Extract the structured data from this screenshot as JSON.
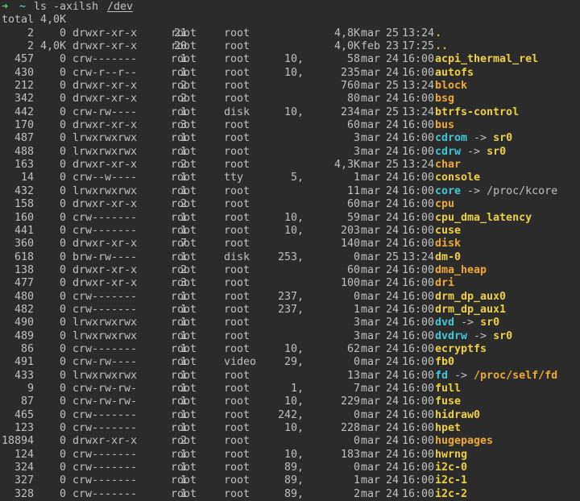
{
  "prompt": {
    "arrow": "➜",
    "cwd": "~",
    "command": "ls -axilsh",
    "argument": "/dev"
  },
  "total_line": "total 4,0K",
  "entries": [
    {
      "inode": "2",
      "blocks": "0",
      "perm": "drwxr-xr-x",
      "links": "21",
      "owner": "root",
      "group": "root",
      "major": "",
      "size": "4,8K",
      "month": "mar",
      "day": "25",
      "time": "13:24",
      "name": ".",
      "kind": "dot",
      "target": "",
      "target_kind": ""
    },
    {
      "inode": "2",
      "blocks": "4,0K",
      "perm": "drwxr-xr-x",
      "links": "20",
      "owner": "root",
      "group": "root",
      "major": "",
      "size": "4,0K",
      "month": "feb",
      "day": "23",
      "time": "17:25",
      "name": "..",
      "kind": "dot",
      "target": "",
      "target_kind": ""
    },
    {
      "inode": "457",
      "blocks": "0",
      "perm": "crw-------",
      "links": "1",
      "owner": "root",
      "group": "root",
      "major": "10,",
      "size": "58",
      "month": "mar",
      "day": "24",
      "time": "16:00",
      "name": "acpi_thermal_rel",
      "kind": "char",
      "target": "",
      "target_kind": ""
    },
    {
      "inode": "430",
      "blocks": "0",
      "perm": "crw-r--r--",
      "links": "1",
      "owner": "root",
      "group": "root",
      "major": "10,",
      "size": "235",
      "month": "mar",
      "day": "24",
      "time": "16:00",
      "name": "autofs",
      "kind": "char",
      "target": "",
      "target_kind": ""
    },
    {
      "inode": "212",
      "blocks": "0",
      "perm": "drwxr-xr-x",
      "links": "2",
      "owner": "root",
      "group": "root",
      "major": "",
      "size": "760",
      "month": "mar",
      "day": "25",
      "time": "13:24",
      "name": "block",
      "kind": "dir",
      "target": "",
      "target_kind": ""
    },
    {
      "inode": "342",
      "blocks": "0",
      "perm": "drwxr-xr-x",
      "links": "2",
      "owner": "root",
      "group": "root",
      "major": "",
      "size": "80",
      "month": "mar",
      "day": "24",
      "time": "16:00",
      "name": "bsg",
      "kind": "dir",
      "target": "",
      "target_kind": ""
    },
    {
      "inode": "442",
      "blocks": "0",
      "perm": "crw-rw----",
      "links": "1",
      "owner": "root",
      "group": "disk",
      "major": "10,",
      "size": "234",
      "month": "mar",
      "day": "25",
      "time": "13:24",
      "name": "btrfs-control",
      "kind": "char",
      "target": "",
      "target_kind": ""
    },
    {
      "inode": "170",
      "blocks": "0",
      "perm": "drwxr-xr-x",
      "links": "3",
      "owner": "root",
      "group": "root",
      "major": "",
      "size": "60",
      "month": "mar",
      "day": "24",
      "time": "16:00",
      "name": "bus",
      "kind": "dir",
      "target": "",
      "target_kind": ""
    },
    {
      "inode": "487",
      "blocks": "0",
      "perm": "lrwxrwxrwx",
      "links": "1",
      "owner": "root",
      "group": "root",
      "major": "",
      "size": "3",
      "month": "mar",
      "day": "24",
      "time": "16:00",
      "name": "cdrom",
      "kind": "link",
      "target": "sr0",
      "target_kind": "char"
    },
    {
      "inode": "488",
      "blocks": "0",
      "perm": "lrwxrwxrwx",
      "links": "1",
      "owner": "root",
      "group": "root",
      "major": "",
      "size": "3",
      "month": "mar",
      "day": "24",
      "time": "16:00",
      "name": "cdrw",
      "kind": "link",
      "target": "sr0",
      "target_kind": "char"
    },
    {
      "inode": "163",
      "blocks": "0",
      "perm": "drwxr-xr-x",
      "links": "2",
      "owner": "root",
      "group": "root",
      "major": "",
      "size": "4,3K",
      "month": "mar",
      "day": "25",
      "time": "13:24",
      "name": "char",
      "kind": "dir",
      "target": "",
      "target_kind": ""
    },
    {
      "inode": "14",
      "blocks": "0",
      "perm": "crw--w----",
      "links": "1",
      "owner": "root",
      "group": "tty",
      "major": "5,",
      "size": "1",
      "month": "mar",
      "day": "24",
      "time": "16:00",
      "name": "console",
      "kind": "char",
      "target": "",
      "target_kind": ""
    },
    {
      "inode": "432",
      "blocks": "0",
      "perm": "lrwxrwxrwx",
      "links": "1",
      "owner": "root",
      "group": "root",
      "major": "",
      "size": "11",
      "month": "mar",
      "day": "24",
      "time": "16:00",
      "name": "core",
      "kind": "link",
      "target": "/proc/kcore",
      "target_kind": "plain"
    },
    {
      "inode": "158",
      "blocks": "0",
      "perm": "drwxr-xr-x",
      "links": "2",
      "owner": "root",
      "group": "root",
      "major": "",
      "size": "60",
      "month": "mar",
      "day": "24",
      "time": "16:00",
      "name": "cpu",
      "kind": "dir",
      "target": "",
      "target_kind": ""
    },
    {
      "inode": "160",
      "blocks": "0",
      "perm": "crw-------",
      "links": "1",
      "owner": "root",
      "group": "root",
      "major": "10,",
      "size": "59",
      "month": "mar",
      "day": "24",
      "time": "16:00",
      "name": "cpu_dma_latency",
      "kind": "char",
      "target": "",
      "target_kind": ""
    },
    {
      "inode": "441",
      "blocks": "0",
      "perm": "crw-------",
      "links": "1",
      "owner": "root",
      "group": "root",
      "major": "10,",
      "size": "203",
      "month": "mar",
      "day": "24",
      "time": "16:00",
      "name": "cuse",
      "kind": "char",
      "target": "",
      "target_kind": ""
    },
    {
      "inode": "360",
      "blocks": "0",
      "perm": "drwxr-xr-x",
      "links": "7",
      "owner": "root",
      "group": "root",
      "major": "",
      "size": "140",
      "month": "mar",
      "day": "24",
      "time": "16:00",
      "name": "disk",
      "kind": "dir",
      "target": "",
      "target_kind": ""
    },
    {
      "inode": "618",
      "blocks": "0",
      "perm": "brw-rw----",
      "links": "1",
      "owner": "root",
      "group": "disk",
      "major": "253,",
      "size": "0",
      "month": "mar",
      "day": "25",
      "time": "13:24",
      "name": "dm-0",
      "kind": "block",
      "target": "",
      "target_kind": ""
    },
    {
      "inode": "138",
      "blocks": "0",
      "perm": "drwxr-xr-x",
      "links": "2",
      "owner": "root",
      "group": "root",
      "major": "",
      "size": "60",
      "month": "mar",
      "day": "24",
      "time": "16:00",
      "name": "dma_heap",
      "kind": "dir",
      "target": "",
      "target_kind": ""
    },
    {
      "inode": "477",
      "blocks": "0",
      "perm": "drwxr-xr-x",
      "links": "3",
      "owner": "root",
      "group": "root",
      "major": "",
      "size": "100",
      "month": "mar",
      "day": "24",
      "time": "16:00",
      "name": "dri",
      "kind": "dir",
      "target": "",
      "target_kind": ""
    },
    {
      "inode": "480",
      "blocks": "0",
      "perm": "crw-------",
      "links": "1",
      "owner": "root",
      "group": "root",
      "major": "237,",
      "size": "0",
      "month": "mar",
      "day": "24",
      "time": "16:00",
      "name": "drm_dp_aux0",
      "kind": "char",
      "target": "",
      "target_kind": ""
    },
    {
      "inode": "482",
      "blocks": "0",
      "perm": "crw-------",
      "links": "1",
      "owner": "root",
      "group": "root",
      "major": "237,",
      "size": "1",
      "month": "mar",
      "day": "24",
      "time": "16:00",
      "name": "drm_dp_aux1",
      "kind": "char",
      "target": "",
      "target_kind": ""
    },
    {
      "inode": "490",
      "blocks": "0",
      "perm": "lrwxrwxrwx",
      "links": "1",
      "owner": "root",
      "group": "root",
      "major": "",
      "size": "3",
      "month": "mar",
      "day": "24",
      "time": "16:00",
      "name": "dvd",
      "kind": "link",
      "target": "sr0",
      "target_kind": "char"
    },
    {
      "inode": "489",
      "blocks": "0",
      "perm": "lrwxrwxrwx",
      "links": "1",
      "owner": "root",
      "group": "root",
      "major": "",
      "size": "3",
      "month": "mar",
      "day": "24",
      "time": "16:00",
      "name": "dvdrw",
      "kind": "link",
      "target": "sr0",
      "target_kind": "char"
    },
    {
      "inode": "86",
      "blocks": "0",
      "perm": "crw-------",
      "links": "1",
      "owner": "root",
      "group": "root",
      "major": "10,",
      "size": "62",
      "month": "mar",
      "day": "24",
      "time": "16:00",
      "name": "ecryptfs",
      "kind": "char",
      "target": "",
      "target_kind": ""
    },
    {
      "inode": "491",
      "blocks": "0",
      "perm": "crw-rw----",
      "links": "1",
      "owner": "root",
      "group": "video",
      "major": "29,",
      "size": "0",
      "month": "mar",
      "day": "24",
      "time": "16:00",
      "name": "fb0",
      "kind": "char",
      "target": "",
      "target_kind": ""
    },
    {
      "inode": "433",
      "blocks": "0",
      "perm": "lrwxrwxrwx",
      "links": "1",
      "owner": "root",
      "group": "root",
      "major": "",
      "size": "13",
      "month": "mar",
      "day": "24",
      "time": "16:00",
      "name": "fd",
      "kind": "link",
      "target": "/proc/self/fd",
      "target_kind": "dir"
    },
    {
      "inode": "9",
      "blocks": "0",
      "perm": "crw-rw-rw-",
      "links": "1",
      "owner": "root",
      "group": "root",
      "major": "1,",
      "size": "7",
      "month": "mar",
      "day": "24",
      "time": "16:00",
      "name": "full",
      "kind": "char",
      "target": "",
      "target_kind": ""
    },
    {
      "inode": "87",
      "blocks": "0",
      "perm": "crw-rw-rw-",
      "links": "1",
      "owner": "root",
      "group": "root",
      "major": "10,",
      "size": "229",
      "month": "mar",
      "day": "24",
      "time": "16:00",
      "name": "fuse",
      "kind": "char",
      "target": "",
      "target_kind": ""
    },
    {
      "inode": "465",
      "blocks": "0",
      "perm": "crw-------",
      "links": "1",
      "owner": "root",
      "group": "root",
      "major": "242,",
      "size": "0",
      "month": "mar",
      "day": "24",
      "time": "16:00",
      "name": "hidraw0",
      "kind": "char",
      "target": "",
      "target_kind": ""
    },
    {
      "inode": "123",
      "blocks": "0",
      "perm": "crw-------",
      "links": "1",
      "owner": "root",
      "group": "root",
      "major": "10,",
      "size": "228",
      "month": "mar",
      "day": "24",
      "time": "16:00",
      "name": "hpet",
      "kind": "char",
      "target": "",
      "target_kind": ""
    },
    {
      "inode": "18894",
      "blocks": "0",
      "perm": "drwxr-xr-x",
      "links": "2",
      "owner": "root",
      "group": "root",
      "major": "",
      "size": "0",
      "month": "mar",
      "day": "24",
      "time": "16:00",
      "name": "hugepages",
      "kind": "dir",
      "target": "",
      "target_kind": ""
    },
    {
      "inode": "124",
      "blocks": "0",
      "perm": "crw-------",
      "links": "1",
      "owner": "root",
      "group": "root",
      "major": "10,",
      "size": "183",
      "month": "mar",
      "day": "24",
      "time": "16:00",
      "name": "hwrng",
      "kind": "char",
      "target": "",
      "target_kind": ""
    },
    {
      "inode": "324",
      "blocks": "0",
      "perm": "crw-------",
      "links": "1",
      "owner": "root",
      "group": "root",
      "major": "89,",
      "size": "0",
      "month": "mar",
      "day": "24",
      "time": "16:00",
      "name": "i2c-0",
      "kind": "char",
      "target": "",
      "target_kind": ""
    },
    {
      "inode": "327",
      "blocks": "0",
      "perm": "crw-------",
      "links": "1",
      "owner": "root",
      "group": "root",
      "major": "89,",
      "size": "1",
      "month": "mar",
      "day": "24",
      "time": "16:00",
      "name": "i2c-1",
      "kind": "char",
      "target": "",
      "target_kind": ""
    },
    {
      "inode": "328",
      "blocks": "0",
      "perm": "crw-------",
      "links": "1",
      "owner": "root",
      "group": "root",
      "major": "89,",
      "size": "2",
      "month": "mar",
      "day": "24",
      "time": "16:00",
      "name": "i2c-2",
      "kind": "char",
      "target": "",
      "target_kind": ""
    }
  ],
  "colors": {
    "background": "#2b2b2b",
    "text": "#c0c0c0",
    "prompt_arrow": "#4fd96a",
    "prompt_cwd": "#3fc8d8",
    "directory": "#f0a830",
    "device": "#f0d040",
    "symlink": "#3fc8d8"
  }
}
